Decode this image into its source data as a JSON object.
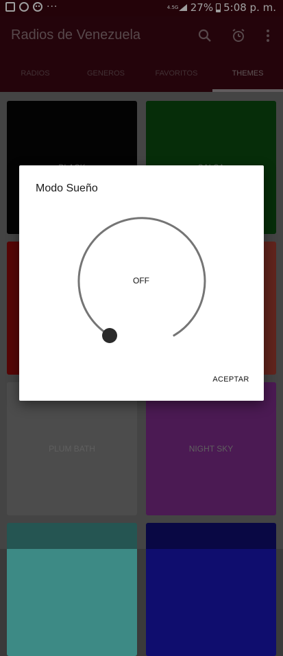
{
  "status_bar": {
    "network": "4.5G",
    "battery": "27%",
    "time": "5:08 p. m.",
    "dots": "···"
  },
  "app_bar": {
    "title": "Radios de Venezuela",
    "icons": [
      "search-icon",
      "alarm-icon",
      "more-vert-icon"
    ]
  },
  "tabs": [
    {
      "label": "RADIOS"
    },
    {
      "label": "GENEROS"
    },
    {
      "label": "FAVORITOS"
    },
    {
      "label": "THEMES"
    }
  ],
  "themes": [
    {
      "label": "BLACK",
      "color": "#050505"
    },
    {
      "label": "SALSA",
      "color": "#0b4a0f"
    },
    {
      "label": "",
      "color": "#8b0a0a"
    },
    {
      "label": "",
      "color": "#9d3a30"
    },
    {
      "label": "PLUM BATH",
      "color": "#7b7b7b"
    },
    {
      "label": "NIGHT SKY",
      "color": "#7a2b86"
    },
    {
      "label": "",
      "color": "#3d8a85"
    },
    {
      "label": "",
      "color": "#0f0d6e"
    }
  ],
  "dialog": {
    "title": "Modo Sueño",
    "value": "OFF",
    "accept_label": "ACEPTAR"
  },
  "colors": {
    "app_bar": "#3b0712",
    "dial_track": "#757575",
    "dial_knob": "#2b2b2b"
  }
}
